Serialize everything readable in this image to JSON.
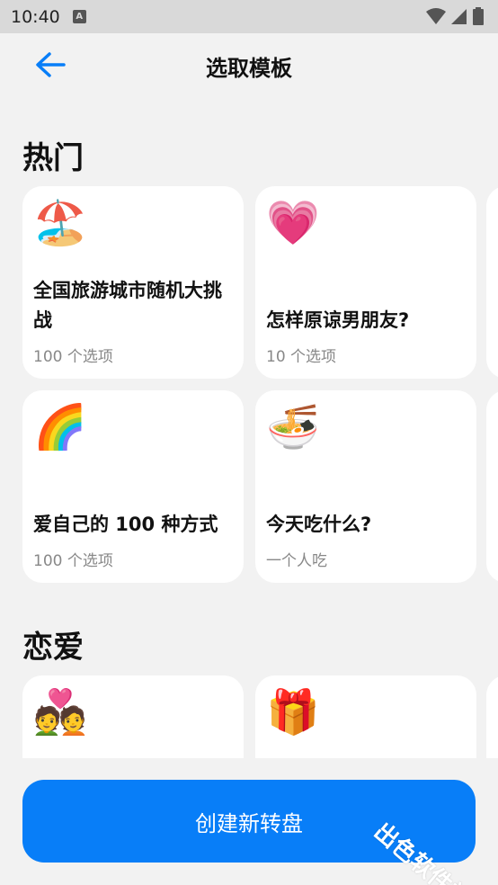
{
  "status_bar": {
    "time": "10:40",
    "badge": "A"
  },
  "header": {
    "title": "选取模板"
  },
  "sections": [
    {
      "title": "热门",
      "cards": [
        {
          "emoji": "🏖️",
          "title": "全国旅游城市随机大挑战",
          "subtitle": "100 个选项"
        },
        {
          "emoji": "💗",
          "title": "怎样原谅男朋友?",
          "subtitle": "10 个选项"
        },
        {
          "emoji": "🌈",
          "title": "爱自己的 100 种方式",
          "subtitle": "100 个选项"
        },
        {
          "emoji": "🍜",
          "title": "今天吃什么?",
          "subtitle": "一个人吃"
        }
      ]
    },
    {
      "title": "恋爱",
      "cards": [
        {
          "emoji": "💑",
          "title": "",
          "subtitle": ""
        },
        {
          "emoji": "🎁",
          "title": "",
          "subtitle": ""
        }
      ]
    }
  ],
  "create_button": {
    "label": "创建新转盘"
  },
  "watermark": "出色软件站",
  "colors": {
    "accent": "#087ef8",
    "background": "#f2f2f2",
    "card": "#ffffff"
  }
}
